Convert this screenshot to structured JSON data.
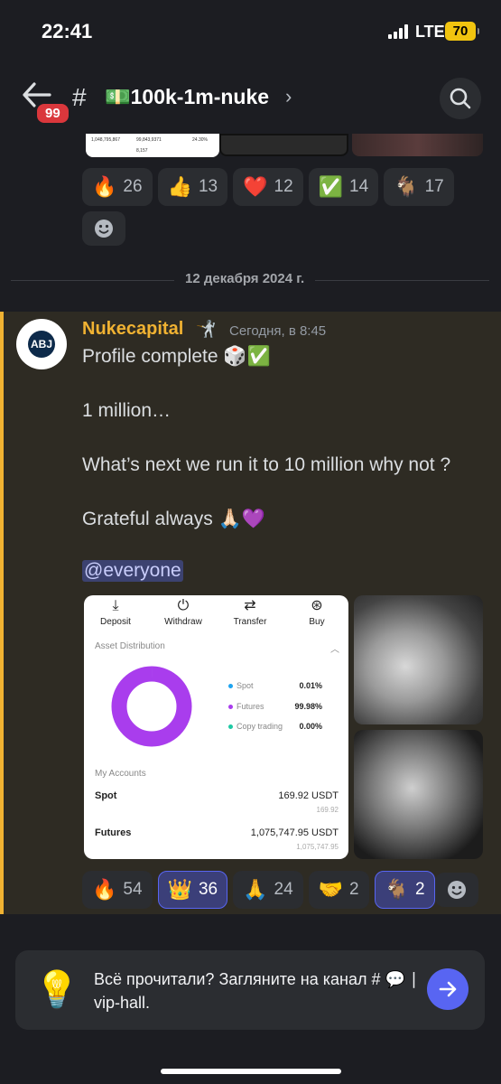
{
  "status": {
    "time": "22:41",
    "network": "LTE",
    "battery": "70"
  },
  "header": {
    "unread_badge": "99",
    "hash": "#",
    "channel": "💵100k-1m-nuke",
    "chevron": "›"
  },
  "top_thumbnail_text": [
    "1,048,795,867",
    "99,843,9371",
    "24.30%",
    "8,157"
  ],
  "prev_reactions": [
    {
      "emoji": "🔥",
      "count": "26"
    },
    {
      "emoji": "👍",
      "count": "13"
    },
    {
      "emoji": "❤️",
      "count": "12"
    },
    {
      "emoji": "✅",
      "count": "14"
    },
    {
      "emoji": "🐐",
      "count": "17"
    }
  ],
  "date_divider": "12 декабря 2024 г.",
  "message": {
    "author": "Nukecapital",
    "author_badge": "🤺",
    "timestamp": "Сегодня, в 8:45",
    "avatar_initials": "ABJ",
    "lines": [
      "Profile complete 🎲✅",
      "1 million…",
      "What’s next we run it to 10 million why not ?",
      "Grateful always 🙏🏻💜"
    ],
    "mention": "@everyone"
  },
  "attachment": {
    "buttons": [
      {
        "icon": "⤓",
        "label": "Deposit"
      },
      {
        "icon": "⏻",
        "label": "Withdraw"
      },
      {
        "icon": "⇄",
        "label": "Transfer"
      },
      {
        "icon": "⊛",
        "label": "Buy"
      }
    ],
    "asset_distribution_label": "Asset Distribution",
    "collapse_glyph": "︿",
    "legend": [
      {
        "name": "Spot",
        "value": "0.01%",
        "color": "#1ea4f0"
      },
      {
        "name": "Futures",
        "value": "99.98%",
        "color": "#a93ded"
      },
      {
        "name": "Copy trading",
        "value": "0.00%",
        "color": "#1ec9a4"
      }
    ],
    "accounts_label": "My Accounts",
    "accounts": [
      {
        "name": "Spot",
        "value": "169.92 USDT",
        "sub": "169.92"
      },
      {
        "name": "Futures",
        "value": "1,075,747.95 USDT",
        "sub": "1,075,747.95"
      }
    ]
  },
  "chart_data": {
    "type": "pie",
    "title": "Asset Distribution",
    "categories": [
      "Spot",
      "Futures",
      "Copy trading"
    ],
    "values": [
      0.01,
      99.98,
      0.0
    ],
    "colors": [
      "#1ea4f0",
      "#a93ded",
      "#1ec9a4"
    ]
  },
  "msg_reactions": [
    {
      "emoji": "🔥",
      "count": "54",
      "me": false
    },
    {
      "emoji": "👑",
      "count": "36",
      "me": true
    },
    {
      "emoji": "🙏",
      "count": "24",
      "me": false
    },
    {
      "emoji": "🤝",
      "count": "2",
      "me": false
    },
    {
      "emoji": "🐐",
      "count": "2",
      "me": true
    }
  ],
  "banner": {
    "icon": "💡",
    "text": "Всё прочитали? Загляните на канал # 💬 ∣ vip-hall."
  },
  "colors": {
    "accent": "#5865f2",
    "author": "#f0b232",
    "highlight_bar": "#f0b232",
    "badge": "#da373c"
  }
}
